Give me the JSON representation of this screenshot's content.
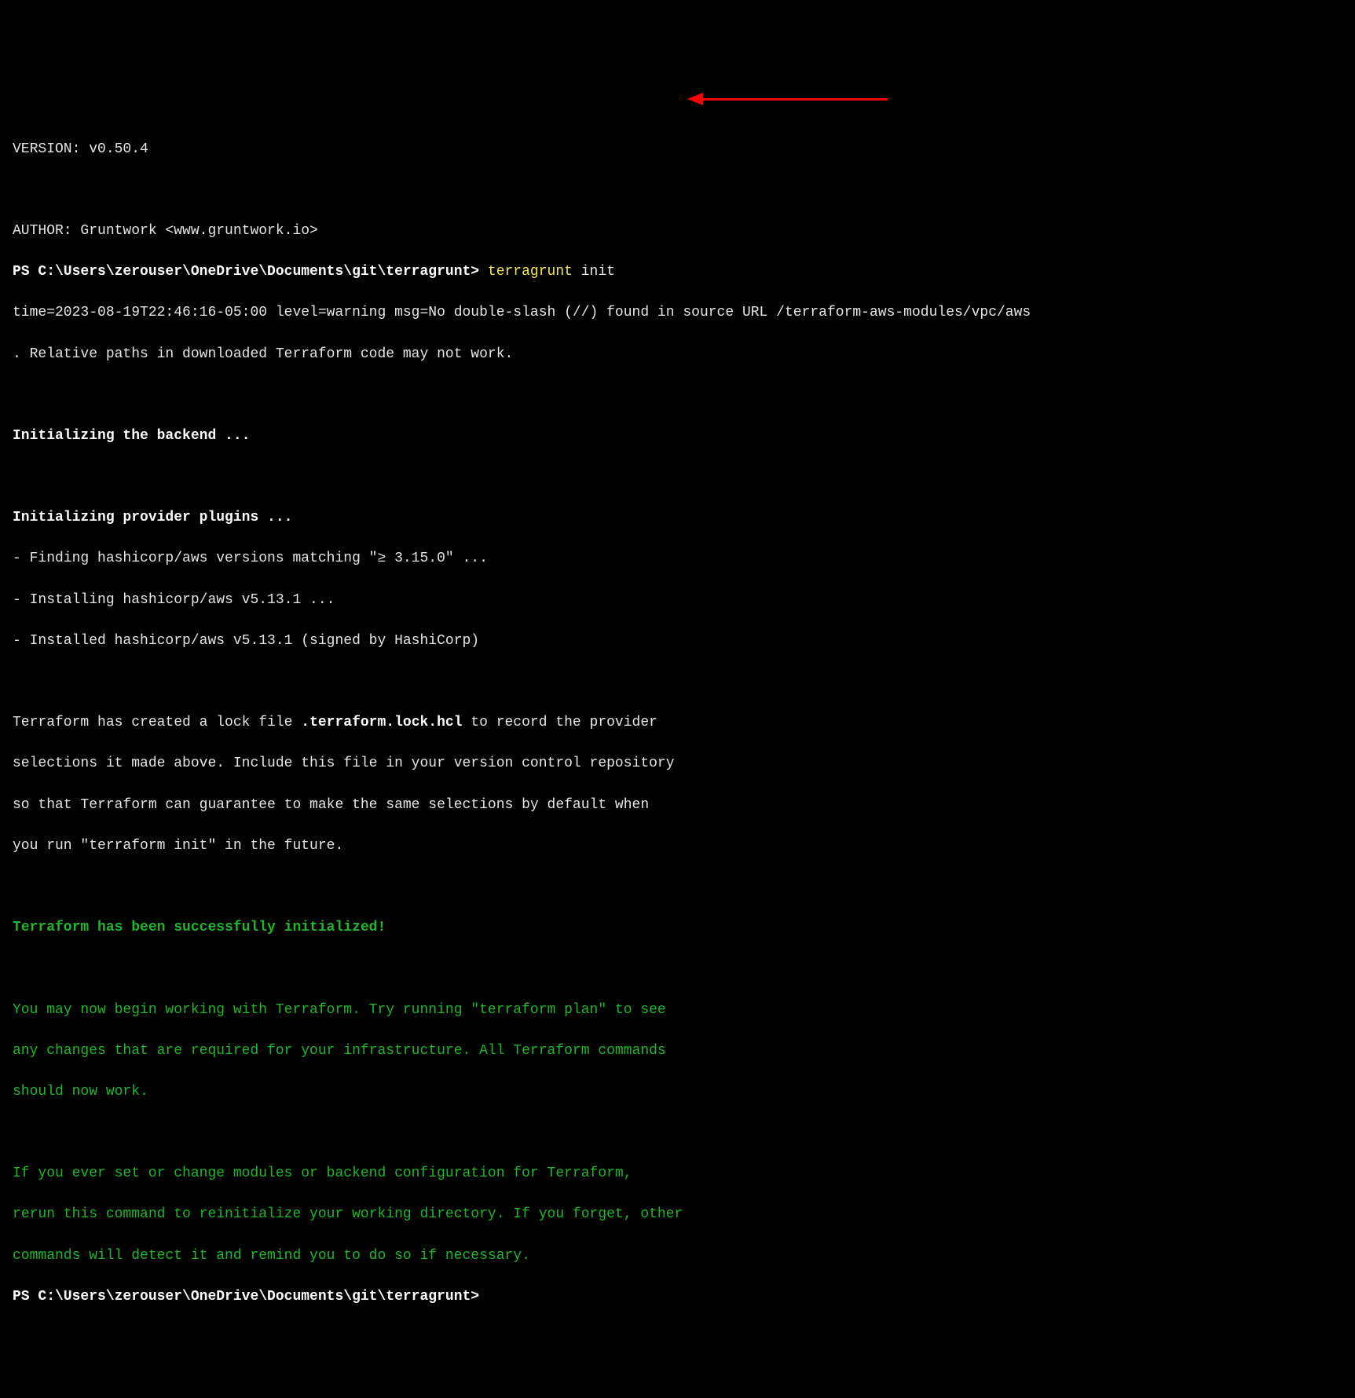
{
  "version_line": "VERSION: v0.50.4",
  "author_line": "AUTHOR: Gruntwork <www.gruntwork.io>",
  "prompt1_prefix": "PS C:\\Users\\zerouser\\OneDrive\\Documents\\git\\terragrunt> ",
  "command_yellow": "terragrunt",
  "command_rest": " init",
  "warning_line1": "time=2023-08-19T22:46:16-05:00 level=warning msg=No double-slash (//) found in source URL /terraform-aws-modules/vpc/aws",
  "warning_line2": ". Relative paths in downloaded Terraform code may not work.",
  "init_backend": "Initializing the backend ...",
  "init_providers": "Initializing provider plugins ...",
  "finding_line": "- Finding hashicorp/aws versions matching \"≥ 3.15.0\" ...",
  "installing_line": "- Installing hashicorp/aws v5.13.1 ...",
  "installed_line": "- Installed hashicorp/aws v5.13.1 (signed by HashiCorp)",
  "lockfile_line1_a": "Terraform has created a lock file ",
  "lockfile_filename": ".terraform.lock.hcl",
  "lockfile_line1_b": " to record the provider",
  "lockfile_line2": "selections it made above. Include this file in your version control repository",
  "lockfile_line3": "so that Terraform can guarantee to make the same selections by default when",
  "lockfile_line4": "you run \"terraform init\" in the future.",
  "success_msg": "Terraform has been successfully initialized!",
  "advice_line1": "You may now begin working with Terraform. Try running \"terraform plan\" to see",
  "advice_line2": "any changes that are required for your infrastructure. All Terraform commands",
  "advice_line3": "should now work.",
  "advice_line4": "If you ever set or change modules or backend configuration for Terraform,",
  "advice_line5": "rerun this command to reinitialize your working directory. If you forget, other",
  "advice_line6": "commands will detect it and remind you to do so if necessary.",
  "prompt2": "PS C:\\Users\\zerouser\\OneDrive\\Documents\\git\\terragrunt>"
}
